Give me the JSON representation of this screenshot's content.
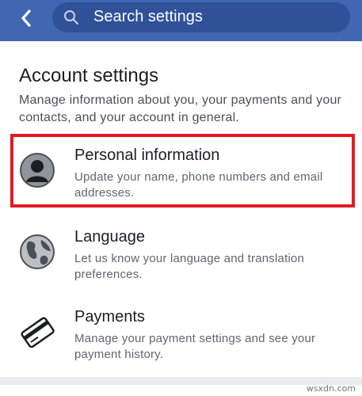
{
  "header": {
    "search_placeholder": "Search settings",
    "accent_color": "#4267b2"
  },
  "account_settings": {
    "title": "Account settings",
    "description": "Manage information about you, your payments and your contacts, and your account in general."
  },
  "items": [
    {
      "label": "Personal information",
      "description": "Update your name, phone numbers and email addresses.",
      "icon": "person-icon",
      "highlighted": true,
      "highlight_color": "#e01b24"
    },
    {
      "label": "Language",
      "description": "Let us know your language and translation preferences.",
      "icon": "globe-icon",
      "highlighted": false
    },
    {
      "label": "Payments",
      "description": "Manage your payment settings and see your payment history.",
      "icon": "credit-card-icon",
      "highlighted": false
    }
  ],
  "watermark": "wsxdn.com"
}
